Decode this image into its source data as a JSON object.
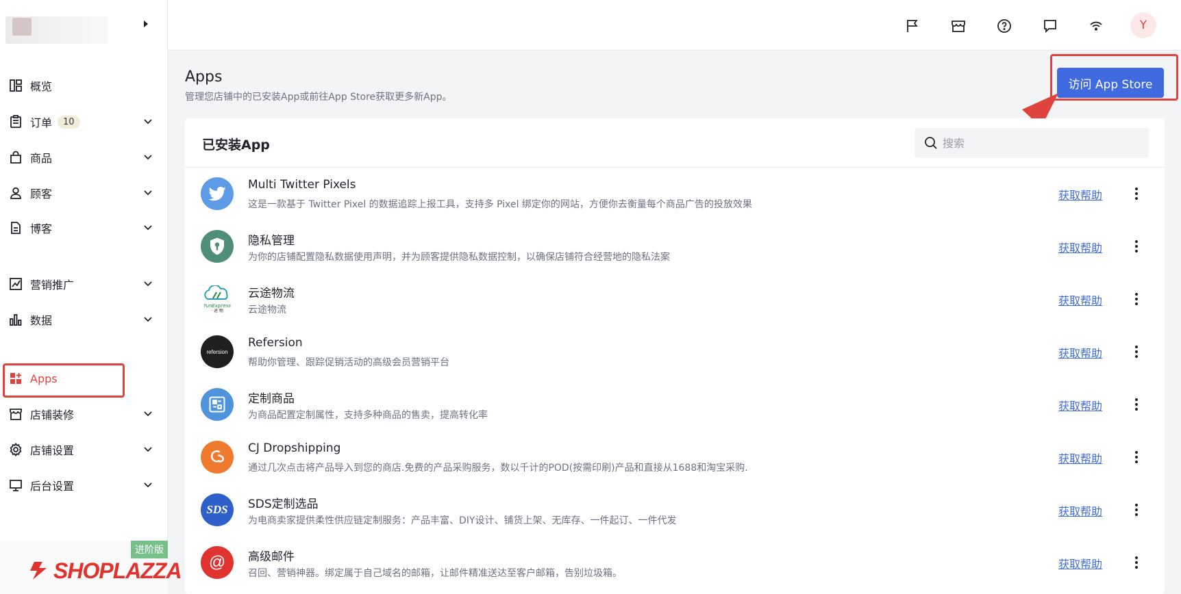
{
  "sidebar": {
    "items": [
      {
        "label": "概览",
        "icon": "dashboard-icon"
      },
      {
        "label": "订单",
        "badge": "10",
        "icon": "order-icon"
      },
      {
        "label": "商品",
        "icon": "product-bag-icon"
      },
      {
        "label": "顾客",
        "icon": "customer-icon"
      },
      {
        "label": "博客",
        "icon": "blog-icon"
      },
      {
        "label": "营销推广",
        "icon": "marketing-icon"
      },
      {
        "label": "数据",
        "icon": "analytics-icon"
      },
      {
        "label": "Apps",
        "icon": "apps-icon"
      },
      {
        "label": "店铺装修",
        "icon": "store-design-icon"
      },
      {
        "label": "店铺设置",
        "icon": "settings-gear-icon"
      },
      {
        "label": "后台设置",
        "icon": "admin-monitor-icon"
      }
    ],
    "brand": {
      "tag": "进阶版",
      "name": "SHOPLAZZA"
    }
  },
  "topbar": {
    "icons": [
      "flag-icon",
      "store-icon",
      "help-icon",
      "chat-icon",
      "wifi-icon"
    ],
    "avatar_initial": "Y"
  },
  "header": {
    "title": "Apps",
    "subtitle": "管理您店铺中的已安装App或前往App Store获取更多新App。",
    "visit_button": "访问 App Store"
  },
  "installed": {
    "title": "已安装App",
    "search_placeholder": "搜索",
    "help_label": "获取帮助",
    "apps": [
      {
        "name": "Multi Twitter Pixels",
        "desc": "这是一款基于 Twitter Pixel 的数据追踪上报工具，支持多 Pixel 绑定你的网站，方便你去衡量每个商品广告的投放效果"
      },
      {
        "name": "隐私管理",
        "desc": "为你的店铺配置隐私数据使用声明，并为顾客提供隐私数据控制，以确保店铺符合经营地的隐私法案"
      },
      {
        "name": "云途物流",
        "desc": "云途物流",
        "logo_text": "YunExpress",
        "logo_subtext": "· 途 物"
      },
      {
        "name": "Refersion",
        "desc": "帮助你管理、跟踪促销活动的高级会员营销平台",
        "logo_text": "refersion"
      },
      {
        "name": "定制商品",
        "desc": "为商品配置定制属性，支持多种商品的售卖，提高转化率"
      },
      {
        "name": "CJ Dropshipping",
        "desc": "通过几次点击将产品导入到您的商店.免费的产品采购服务，数以千计的POD(按需印刷)产品和直接从1688和淘宝采购."
      },
      {
        "name": "SDS定制选品",
        "desc": "为电商卖家提供柔性供应链定制服务：产品丰富、DIY设计、铺货上架、无库存、一件起订、一件代发",
        "logo_text": "SDS"
      },
      {
        "name": "高级邮件",
        "desc": "召回、营销神器。绑定属于自己域名的邮箱，让邮件精准送达至客户邮箱，告别垃圾箱。",
        "logo_text": "@"
      }
    ]
  },
  "colors": {
    "accent": "#3f6ae0",
    "highlight": "#e0433d",
    "brand": "#e0322e"
  }
}
